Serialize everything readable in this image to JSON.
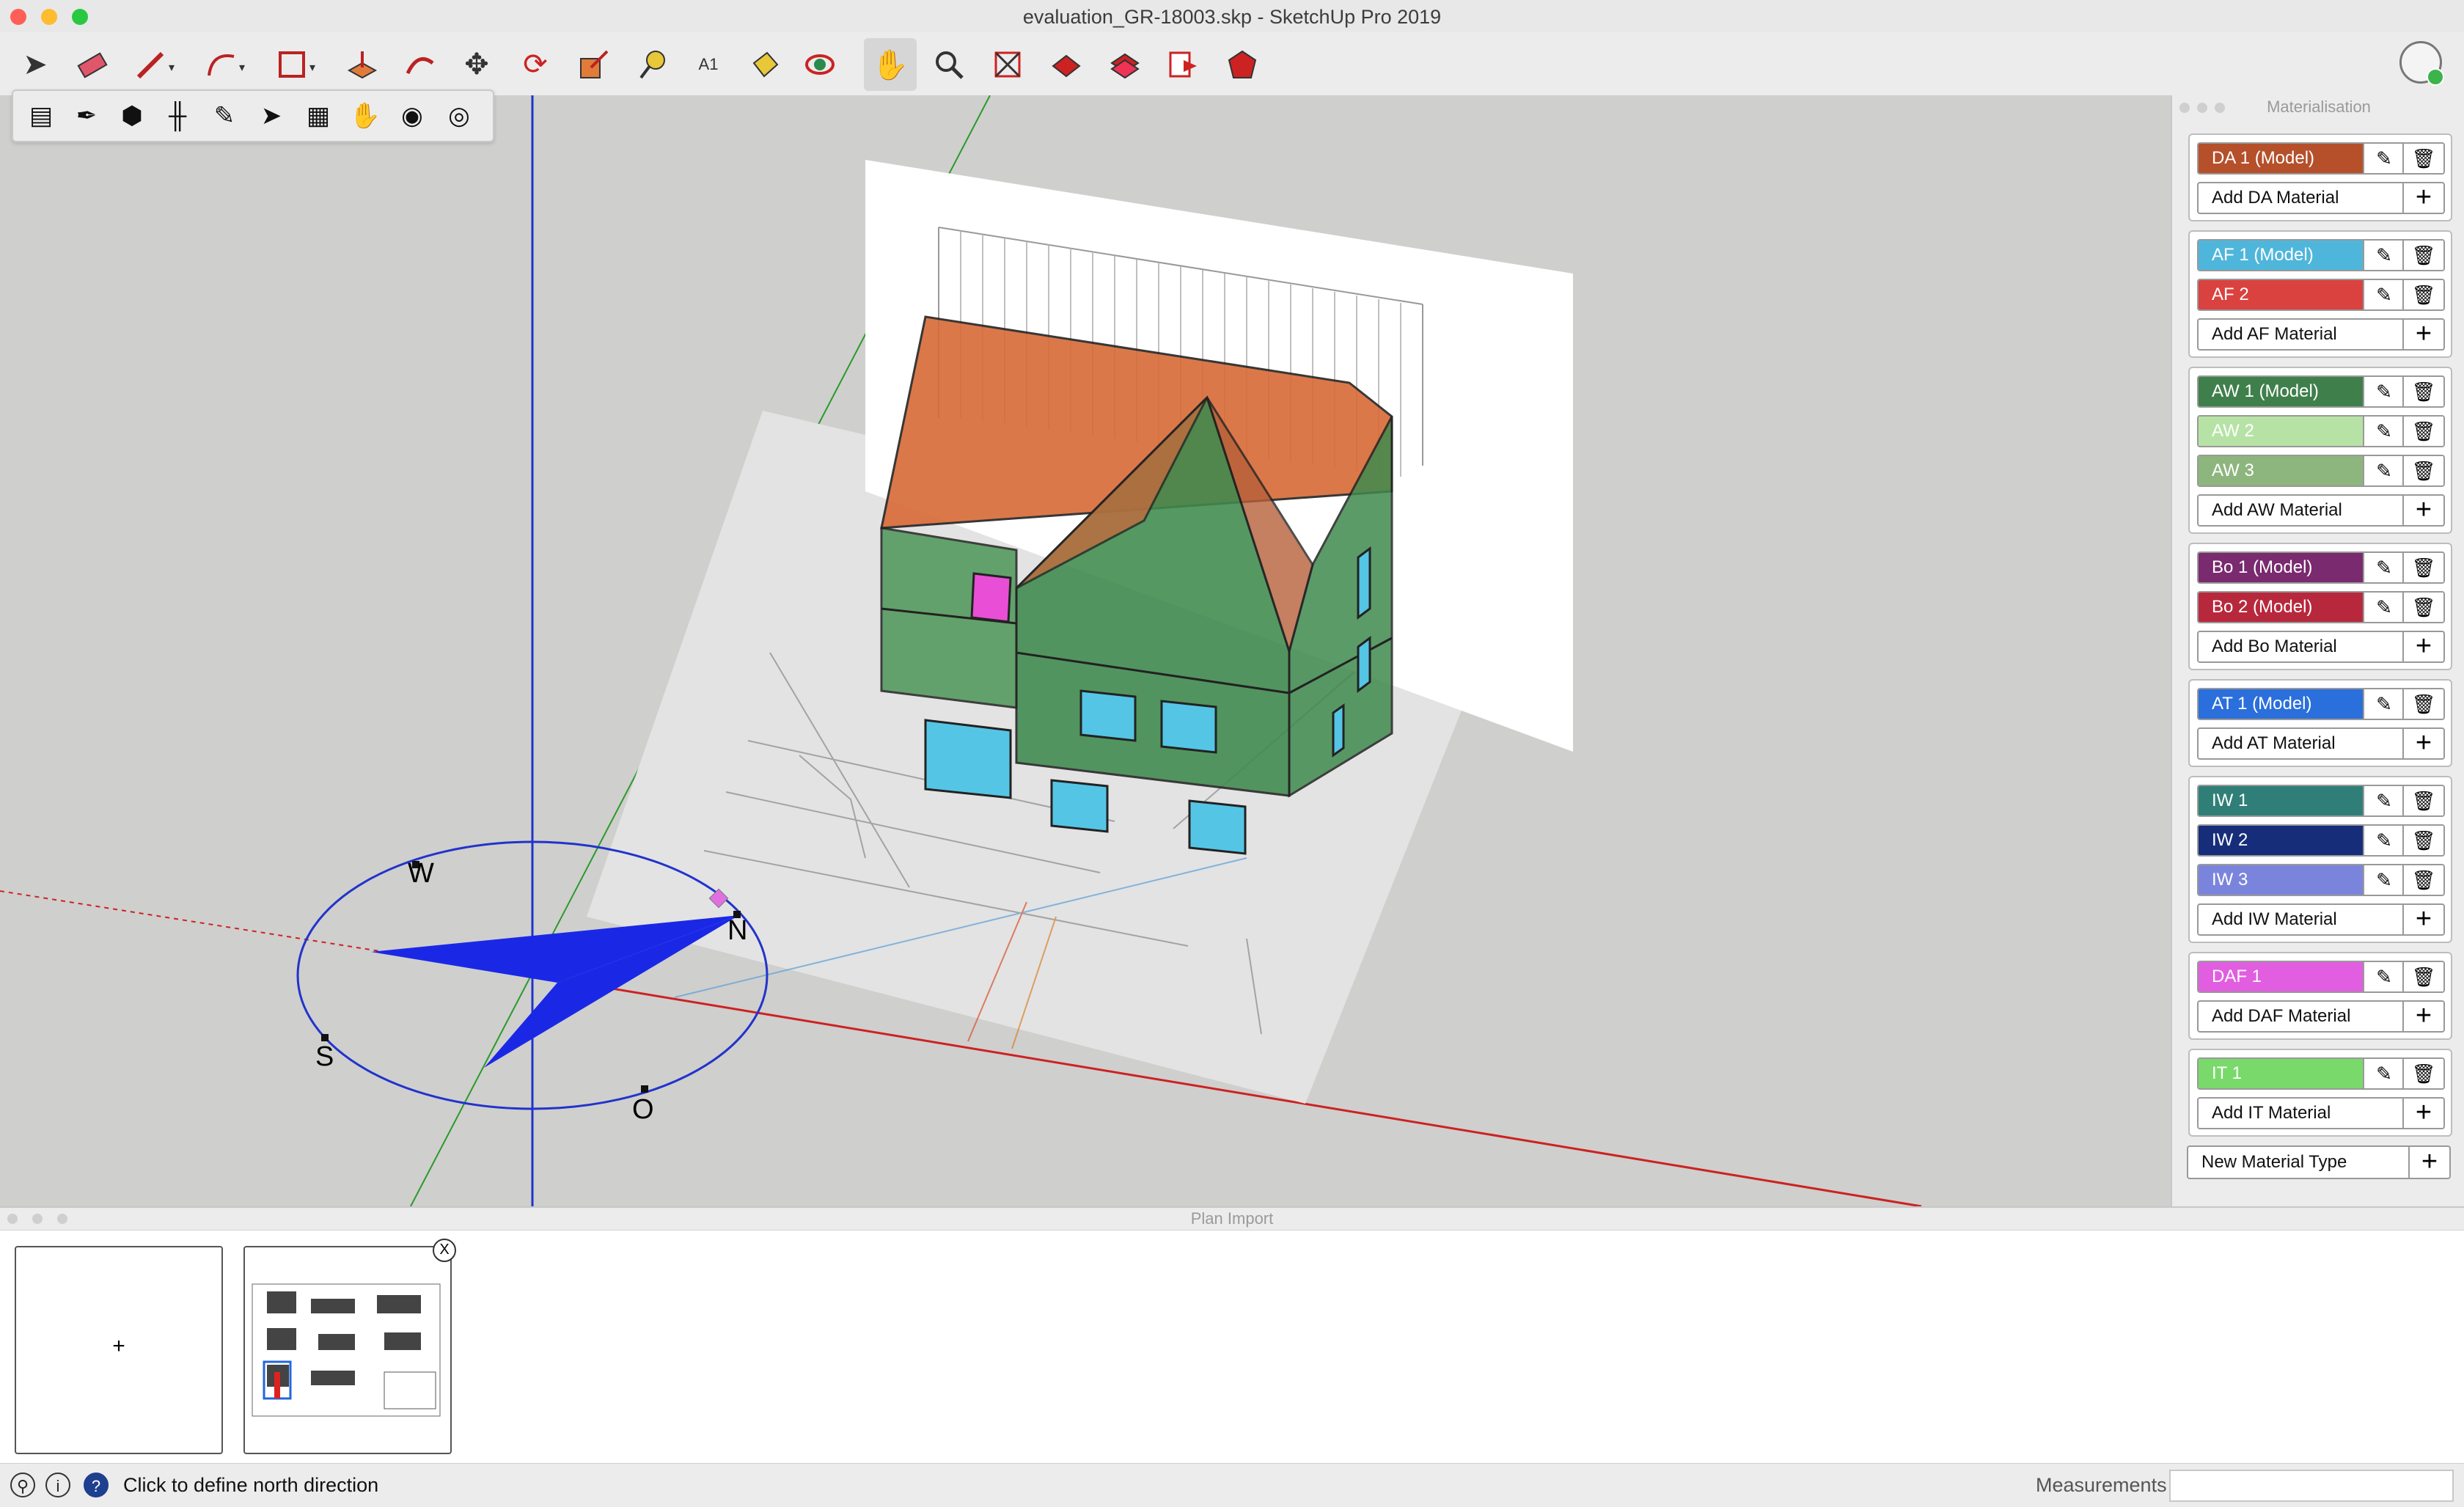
{
  "window": {
    "title": "evaluation_GR-18003.skp - SketchUp Pro 2019"
  },
  "toolbar": {
    "tools": [
      "select-icon",
      "eraser-icon",
      "pencil-icon",
      "arc-icon",
      "rectangle-icon",
      "push-pull-icon",
      "follow-me-icon",
      "move-icon",
      "rotate-icon",
      "scale-icon",
      "tape-measure-icon",
      "text-icon",
      "paint-bucket-icon",
      "orbit-icon",
      "pan-icon",
      "zoom-icon",
      "zoom-extents-icon",
      "warehouse-icon",
      "extension-warehouse-icon",
      "layout-icon",
      "extension-manager-icon"
    ]
  },
  "viewport": {
    "compass": {
      "n": "N",
      "s": "S",
      "w": "W",
      "o": "O"
    }
  },
  "materialisation": {
    "title": "Materialisation",
    "groups": [
      {
        "rows": [
          {
            "label": "DA 1 (Model)",
            "color": "#b5502b"
          }
        ],
        "add": "Add DA Material"
      },
      {
        "rows": [
          {
            "label": "AF 1 (Model)",
            "color": "#4fb6db"
          },
          {
            "label": "AF 2",
            "color": "#d9423f"
          }
        ],
        "add": "Add AF Material"
      },
      {
        "rows": [
          {
            "label": "AW 1 (Model)",
            "color": "#3f7f4b"
          },
          {
            "label": "AW 2",
            "color": "#b6e3a5"
          },
          {
            "label": "AW 3",
            "color": "#8db57e"
          }
        ],
        "add": "Add AW Material"
      },
      {
        "rows": [
          {
            "label": "Bo 1 (Model)",
            "color": "#7a2a6e"
          },
          {
            "label": "Bo 2 (Model)",
            "color": "#b8283c"
          }
        ],
        "add": "Add Bo Material"
      },
      {
        "rows": [
          {
            "label": "AT 1 (Model)",
            "color": "#2a6fdb"
          }
        ],
        "add": "Add AT Material"
      },
      {
        "rows": [
          {
            "label": "IW 1",
            "color": "#2f7f78"
          },
          {
            "label": "IW 2",
            "color": "#162d7a"
          },
          {
            "label": "IW 3",
            "color": "#7b84dc"
          }
        ],
        "add": "Add IW Material"
      },
      {
        "rows": [
          {
            "label": "DAF 1",
            "color": "#e15ee0"
          }
        ],
        "add": "Add DAF Material"
      },
      {
        "rows": [
          {
            "label": "IT 1",
            "color": "#79d96b"
          }
        ],
        "add": "Add IT Material"
      }
    ],
    "new_type": "New Material Type"
  },
  "plan_import": {
    "title": "Plan Import",
    "add_label": "+",
    "close_label": "X"
  },
  "status": {
    "message": "Click to define north direction",
    "measurements_label": "Measurements",
    "measurements_value": ""
  }
}
